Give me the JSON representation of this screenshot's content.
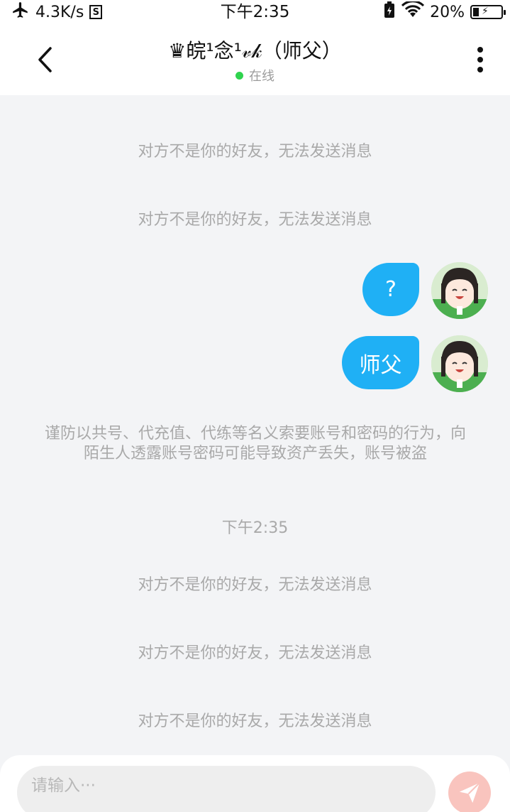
{
  "status_bar": {
    "net_speed": "4.3K/s",
    "time": "下午2:35",
    "battery": "20%",
    "battery_level": 0.2,
    "icons": [
      "airplane-icon",
      "s-notification-icon",
      "battery-saver-icon",
      "wifi-icon",
      "battery-icon"
    ]
  },
  "header": {
    "contact_name": "♛皖¹念¹𝓋𝓀（师父）",
    "status": "在线",
    "online_color": "#2fd34e"
  },
  "messages": {
    "system_1": "对方不是你的好友，无法发送消息",
    "system_2": "对方不是你的好友，无法发送消息",
    "sent_1": "?",
    "sent_2": "师父",
    "warning": "谨防以共号、代充值、代练等名义索要账号和密码的行为，向陌生人透露账号密码可能导致资产丢失，账号被盗",
    "timestamp": "下午2:35",
    "system_3": "对方不是你的好友，无法发送消息",
    "system_4": "对方不是你的好友，无法发送消息",
    "system_5": "对方不是你的好友，无法发送消息"
  },
  "input": {
    "placeholder": "请输入···",
    "value": ""
  },
  "colors": {
    "bubble": "#1fb0f5",
    "background": "#f3f4f6",
    "send_button": "#f9c4be"
  }
}
